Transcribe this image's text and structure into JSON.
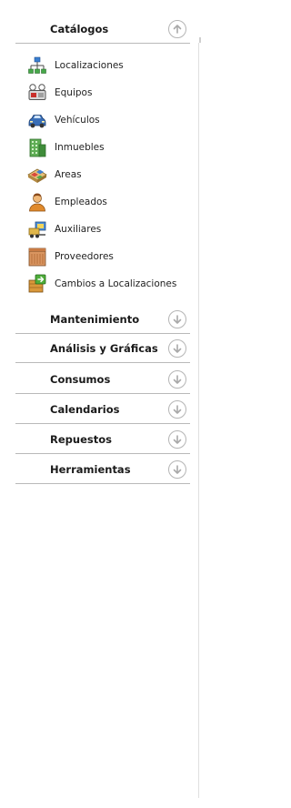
{
  "catalogos": {
    "title": "Catálogos",
    "items": [
      {
        "label": "Localizaciones",
        "icon": "network-icon"
      },
      {
        "label": "Equipos",
        "icon": "machine-icon"
      },
      {
        "label": "Vehículos",
        "icon": "car-icon"
      },
      {
        "label": "Inmuebles",
        "icon": "building-icon"
      },
      {
        "label": "Areas",
        "icon": "area-map-icon"
      },
      {
        "label": "Empleados",
        "icon": "person-icon"
      },
      {
        "label": "Auxiliares",
        "icon": "forklift-icon"
      },
      {
        "label": "Proveedores",
        "icon": "store-icon"
      },
      {
        "label": "Cambios a Localizaciones",
        "icon": "move-crate-icon"
      }
    ]
  },
  "sections": [
    {
      "title": "Mantenimiento"
    },
    {
      "title": "Análisis y Gráficas"
    },
    {
      "title": "Consumos"
    },
    {
      "title": "Calendarios"
    },
    {
      "title": "Repuestos"
    },
    {
      "title": "Herramientas"
    }
  ]
}
